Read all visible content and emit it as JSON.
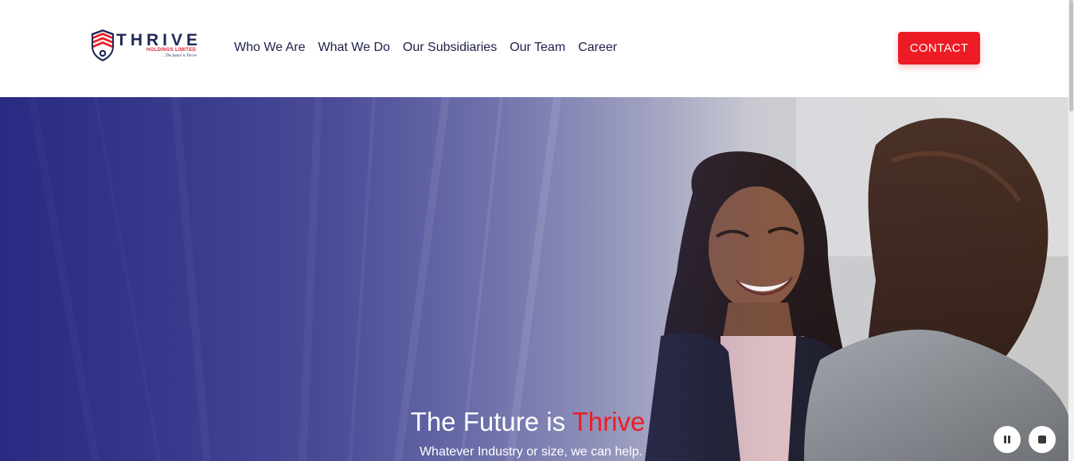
{
  "brand": {
    "name": "THRIVE",
    "subtitle": "HOLDINGS LIMITED",
    "tagline": "...The future is Thrive",
    "colors": {
      "navy": "#1f2756",
      "red": "#ed1c24"
    }
  },
  "nav": {
    "items": [
      {
        "label": "Who We Are"
      },
      {
        "label": "What We Do"
      },
      {
        "label": "Our Subsidiaries"
      },
      {
        "label": "Our Team"
      },
      {
        "label": "Career"
      }
    ],
    "contact_label": "CONTACT"
  },
  "hero": {
    "title_prefix": "The Future is ",
    "title_accent": "Thrive",
    "subtitle": "Whatever Industry or size, we can help."
  },
  "controls": {
    "pause_icon": "pause-icon",
    "stop_icon": "stop-icon"
  }
}
